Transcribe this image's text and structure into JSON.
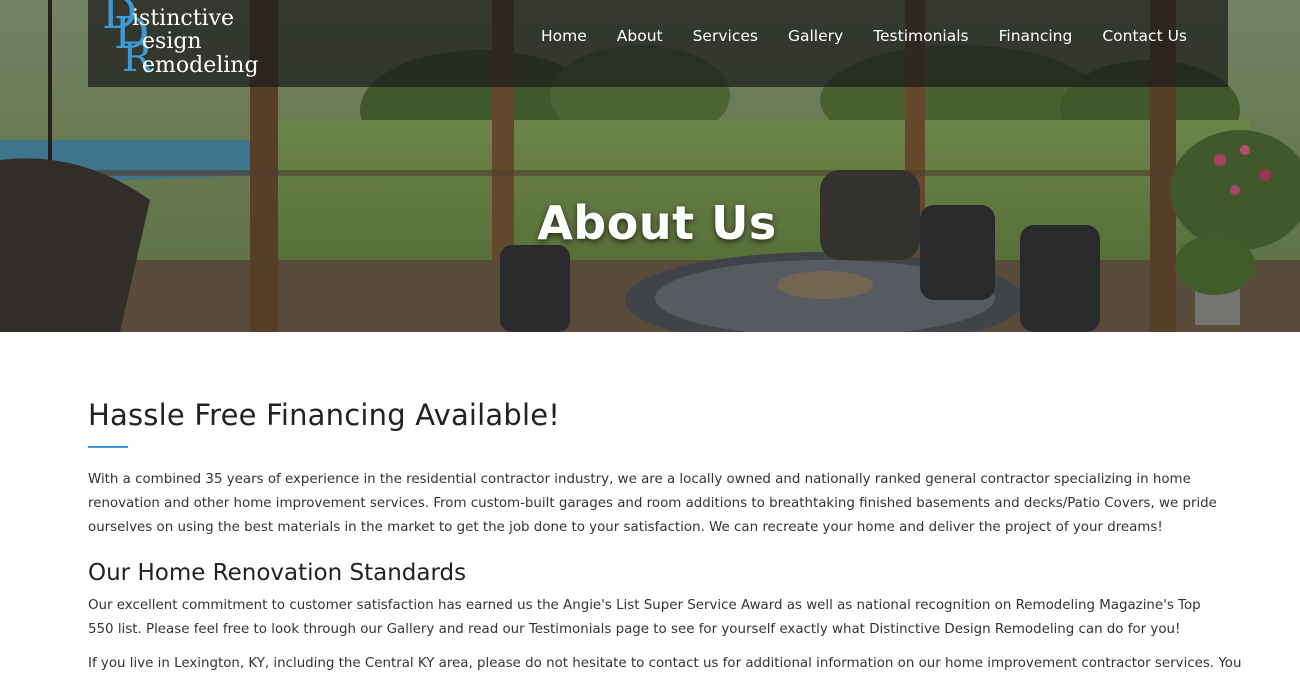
{
  "brand": {
    "logo_word_1": "istinctive",
    "logo_word_2": "esign",
    "logo_word_3": "emodeling",
    "logo_letter_1": "D",
    "logo_letter_2": "D",
    "logo_letter_3": "R",
    "accent_color": "#3b9bd8"
  },
  "nav": {
    "items": [
      {
        "label": "Home"
      },
      {
        "label": "About"
      },
      {
        "label": "Services"
      },
      {
        "label": "Gallery"
      },
      {
        "label": "Testimonials"
      },
      {
        "label": "Financing"
      },
      {
        "label": "Contact Us"
      }
    ]
  },
  "hero": {
    "title": "About Us"
  },
  "main": {
    "heading": "Hassle Free Financing Available!",
    "intro": "With a combined 35 years of experience in the residential contractor industry, we are a locally owned and nationally ranked general contractor specializing in home renovation and other home improvement services. From custom-built garages and room additions to breathtaking finished basements and decks/Patio Covers, we pride ourselves on using the best materials in the market to get the job done to your satisfaction. We can recreate your home and deliver the project of your dreams!",
    "subheading": "Our Home Renovation Standards",
    "standards": "Our excellent commitment to customer satisfaction has earned us the Angie's List Super Service Award as well as national recognition on Remodeling Magazine's Top 550 list. Please feel free to look through our Gallery and read our Testimonials page to see for yourself exactly what Distinctive Design Remodeling can do for you!",
    "partial_line": "If you live in Lexington, KY, including the Central KY area, please do not hesitate to contact us for additional information on our home improvement contractor services. You"
  }
}
